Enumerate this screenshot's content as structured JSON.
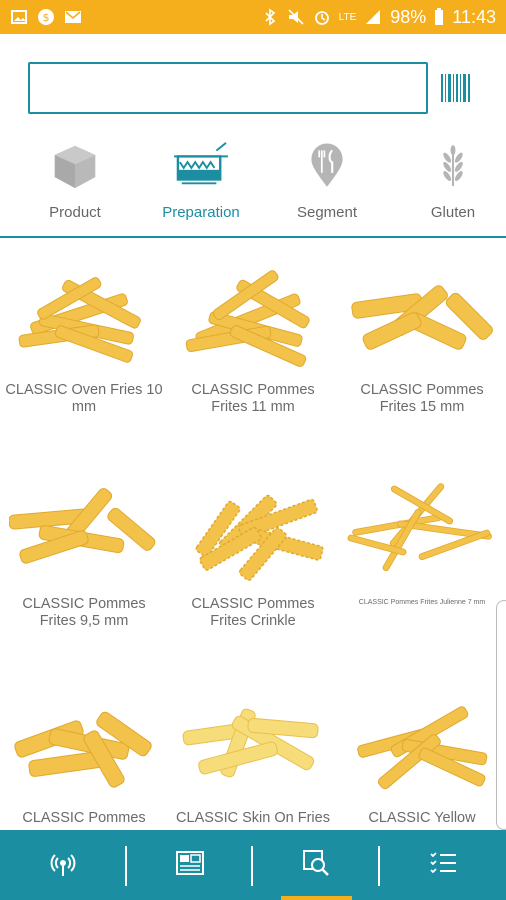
{
  "status_bar": {
    "battery": "98%",
    "time": "11:43",
    "network": "LTE",
    "left_icons": [
      "gallery-icon",
      "coin-icon",
      "mail-icon"
    ],
    "right_icons": [
      "bluetooth-icon",
      "mute-icon",
      "alarm-icon",
      "signal-icon",
      "battery-icon"
    ]
  },
  "search": {
    "value": "",
    "placeholder": ""
  },
  "tabs": [
    {
      "label": "Product",
      "icon": "box-icon",
      "active": false
    },
    {
      "label": "Preparation",
      "icon": "fryer-icon",
      "active": true
    },
    {
      "label": "Segment",
      "icon": "cutlery-pin-icon",
      "active": false
    },
    {
      "label": "Gluten",
      "icon": "wheat-icon",
      "active": false
    }
  ],
  "products": [
    {
      "name": "CLASSIC Oven Fries 10 mm"
    },
    {
      "name": "CLASSIC Pommes Frites 11 mm"
    },
    {
      "name": "CLASSIC Pommes Frites 15 mm"
    },
    {
      "name": "CLASSIC Pommes Frites 9,5 mm"
    },
    {
      "name": "CLASSIC Pommes Frites Crinkle"
    },
    {
      "name": "CLASSIC Pommes Frites Julienne 7 mm"
    },
    {
      "name": "CLASSIC Pommes"
    },
    {
      "name": "CLASSIC Skin On Fries"
    },
    {
      "name": "CLASSIC Yellow"
    }
  ],
  "bottom_nav": [
    {
      "icon": "broadcast-icon"
    },
    {
      "icon": "catalog-icon"
    },
    {
      "icon": "search-product-icon",
      "active": true
    },
    {
      "icon": "checklist-icon"
    }
  ],
  "colors": {
    "accent": "#1b8fa1",
    "status": "#f5ae1c",
    "fries": "#f3c24a"
  }
}
